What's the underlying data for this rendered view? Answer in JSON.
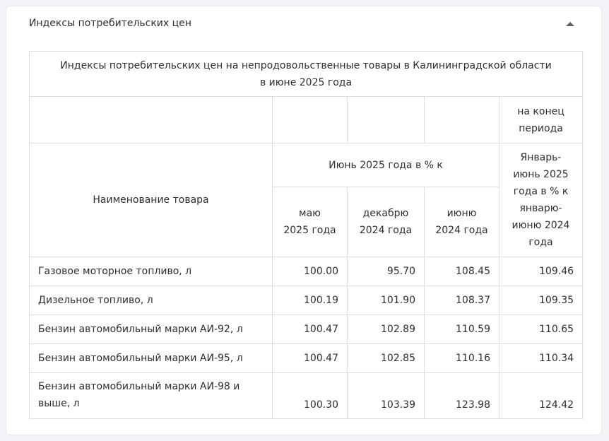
{
  "panel": {
    "title": "Индексы потребительских цен",
    "toggle_icon": "chevron-up-icon"
  },
  "table": {
    "caption_line1": "Индексы потребительских цен на непродовольственные товары в Калининградской области",
    "caption_line2": "в июне 2025 года",
    "end_period_line1": "на конец",
    "end_period_line2": "периода",
    "name_header": "Наименование товара",
    "group_header": "Июнь 2025 года в % к",
    "col_may_1": "маю",
    "col_may_2": "2025 года",
    "col_dec_1": "декабрю",
    "col_dec_2": "2024 года",
    "col_jun_1": "июню",
    "col_jun_2": "2024 года",
    "ytd_lines": [
      "Январь-",
      "июнь 2025",
      "года в % к",
      "январю-",
      "июню 2024",
      "года"
    ],
    "rows": [
      {
        "name": "Газовое моторное топливо, л",
        "may": "100.00",
        "dec": "95.70",
        "jun": "108.45",
        "ytd": "109.46"
      },
      {
        "name": "Дизельное топливо, л",
        "may": "100.19",
        "dec": "101.90",
        "jun": "108.37",
        "ytd": "109.35"
      },
      {
        "name": "Бензин автомобильный марки АИ-92, л",
        "may": "100.47",
        "dec": "102.89",
        "jun": "110.59",
        "ytd": "110.65"
      },
      {
        "name": "Бензин автомобильный марки АИ-95, л",
        "may": "100.47",
        "dec": "102.85",
        "jun": "110.16",
        "ytd": "110.34"
      },
      {
        "name_line1": "Бензин автомобильный марки АИ-98 и",
        "name_line2": "выше, л",
        "may": "100.30",
        "dec": "103.39",
        "jun": "123.98",
        "ytd": "124.42"
      }
    ]
  }
}
